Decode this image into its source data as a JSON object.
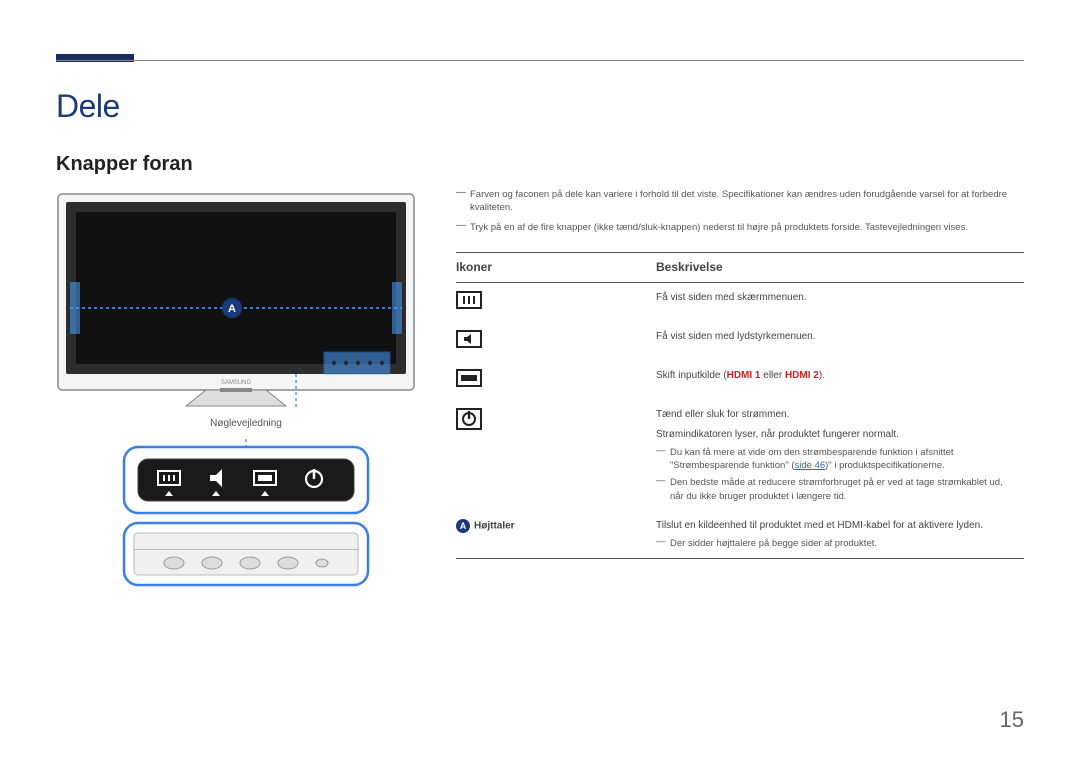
{
  "page": {
    "heading": "Dele",
    "subheading": "Knapper foran",
    "number": "15"
  },
  "diagram": {
    "badge": "A",
    "caption": "Nøglevejledning",
    "brand": "SAMSUNG"
  },
  "notes": {
    "n1": "Farven og faconen på dele kan variere i forhold til det viste. Specifikationer kan ændres uden forudgående varsel for at forbedre kvaliteten.",
    "n2": "Tryk på en af de fire knapper (ikke tænd/sluk-knappen) nederst til højre på produktets forside. Tastevejledningen vises."
  },
  "table": {
    "headers": {
      "icons": "Ikoner",
      "desc": "Beskrivelse"
    },
    "rows": {
      "menu": {
        "desc": "Få vist siden med skærmmenuen."
      },
      "volume": {
        "desc": "Få vist siden med lydstyrkemenuen."
      },
      "source": {
        "prefix": "Skift inputkilde (",
        "a": "HDMI 1",
        "mid": " eller ",
        "b": "HDMI 2",
        "suffix": ")."
      },
      "power": {
        "line1": "Tænd eller sluk for strømmen.",
        "line2": "Strømindikatoren lyser, når produktet fungerer normalt.",
        "sub1a": "Du kan få mere at vide om den strømbesparende funktion i afsnittet \"Strømbesparende funktion\" (",
        "sub1_link": "side 46",
        "sub1b": ")\" i produktspecifikationerne.",
        "sub2": "Den bedste måde at reducere strømforbruget på er ved at tage strømkablet ud, når du ikke bruger produktet i længere tid."
      },
      "speaker": {
        "badge": "A",
        "label": "Højttaler",
        "desc": "Tilslut en kildeenhed til produktet med et HDMI-kabel for at aktivere lyden.",
        "sub": "Der sidder højttalere på begge sider af produktet."
      }
    }
  }
}
